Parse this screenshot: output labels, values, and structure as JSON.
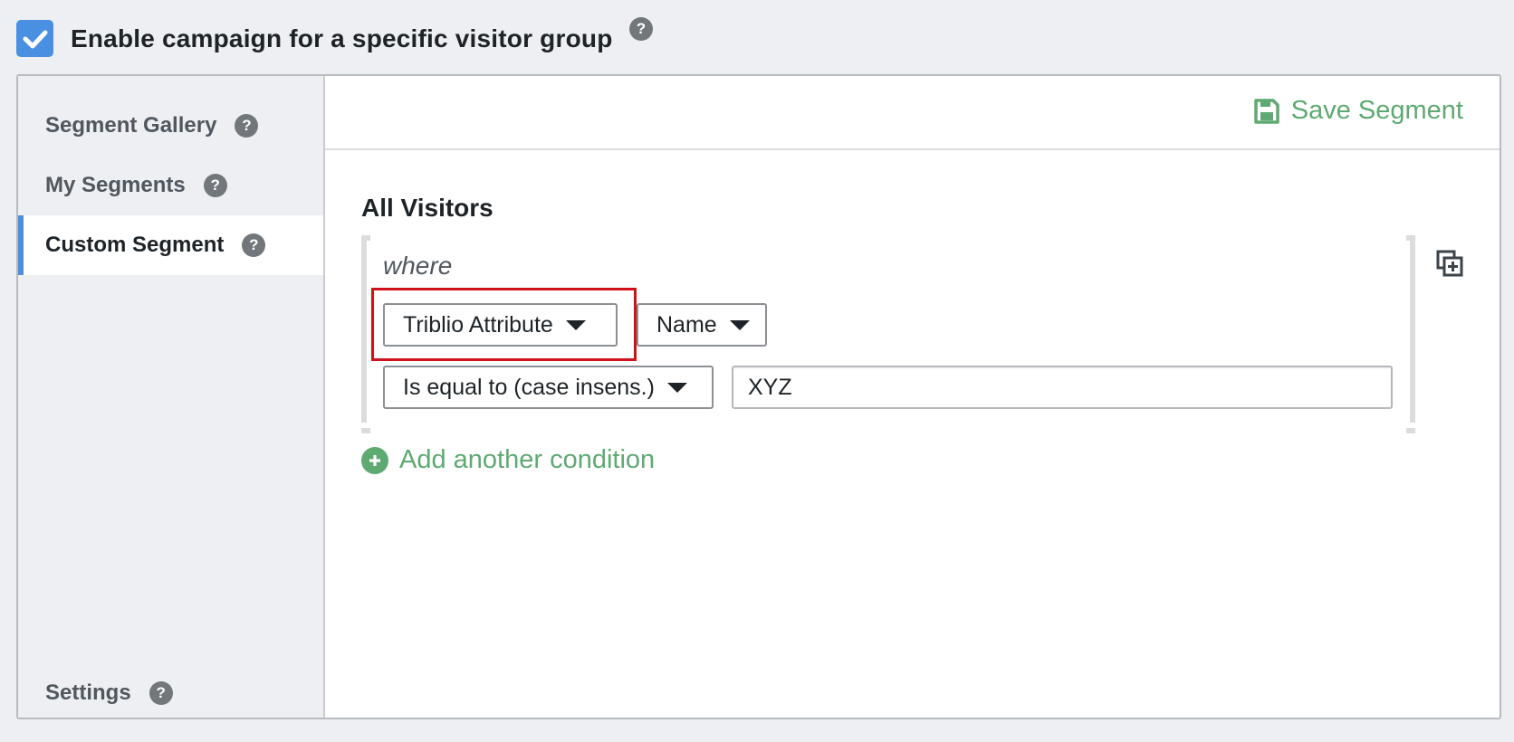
{
  "header": {
    "checkbox_checked": true,
    "label": "Enable campaign for a specific visitor group"
  },
  "sidebar": {
    "items": [
      {
        "label": "Segment Gallery",
        "active": false
      },
      {
        "label": "My Segments",
        "active": false
      },
      {
        "label": "Custom Segment",
        "active": true
      },
      {
        "label": "Settings",
        "active": false
      }
    ]
  },
  "main": {
    "save_label": "Save Segment",
    "group_title": "All Visitors",
    "where_label": "where",
    "condition": {
      "attribute_type": "Triblio Attribute",
      "attribute_name": "Name",
      "operator": "Is equal to (case insens.)",
      "value": "XYZ"
    },
    "add_condition_label": "Add another condition"
  },
  "colors": {
    "accent_blue": "#4a90e2",
    "green": "#5eaa72",
    "highlight_red": "#d0101b"
  },
  "help_glyph": "?"
}
